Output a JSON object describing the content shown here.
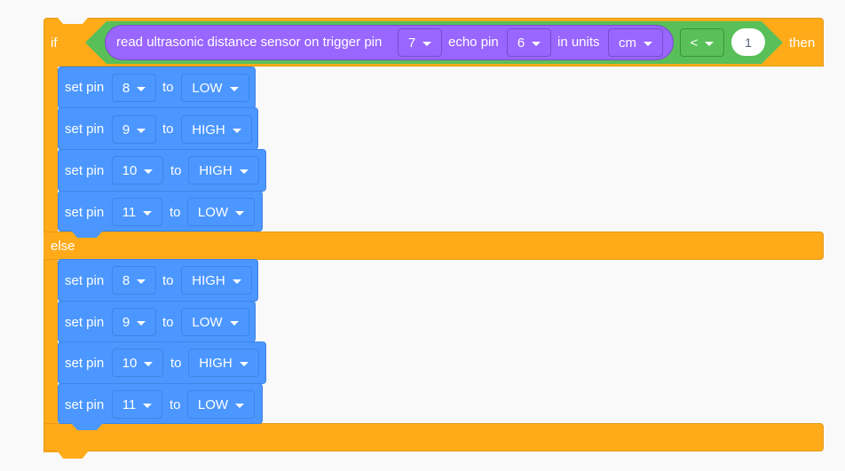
{
  "if_block": {
    "if_label": "if",
    "then_label": "then",
    "else_label": "else",
    "condition": {
      "sensor": {
        "text_prefix": "read ultrasonic distance sensor on trigger pin",
        "trigger_pin": "7",
        "echo_label": "echo pin",
        "echo_pin": "6",
        "units_label": "in units",
        "units": "cm"
      },
      "operator": "<",
      "value": "1"
    },
    "then_blocks": [
      {
        "label": "set pin",
        "pin": "8",
        "to": "to",
        "state": "LOW"
      },
      {
        "label": "set pin",
        "pin": "9",
        "to": "to",
        "state": "HIGH"
      },
      {
        "label": "set pin",
        "pin": "10",
        "to": "to",
        "state": "HIGH"
      },
      {
        "label": "set pin",
        "pin": "11",
        "to": "to",
        "state": "LOW"
      }
    ],
    "else_blocks": [
      {
        "label": "set pin",
        "pin": "8",
        "to": "to",
        "state": "HIGH"
      },
      {
        "label": "set pin",
        "pin": "9",
        "to": "to",
        "state": "LOW"
      },
      {
        "label": "set pin",
        "pin": "10",
        "to": "to",
        "state": "HIGH"
      },
      {
        "label": "set pin",
        "pin": "11",
        "to": "to",
        "state": "LOW"
      }
    ]
  },
  "colors": {
    "control": "#ffab19",
    "operator": "#59c059",
    "sensor": "#9966ff",
    "pins": "#4c97ff",
    "canvas": "#f9f9f9"
  }
}
